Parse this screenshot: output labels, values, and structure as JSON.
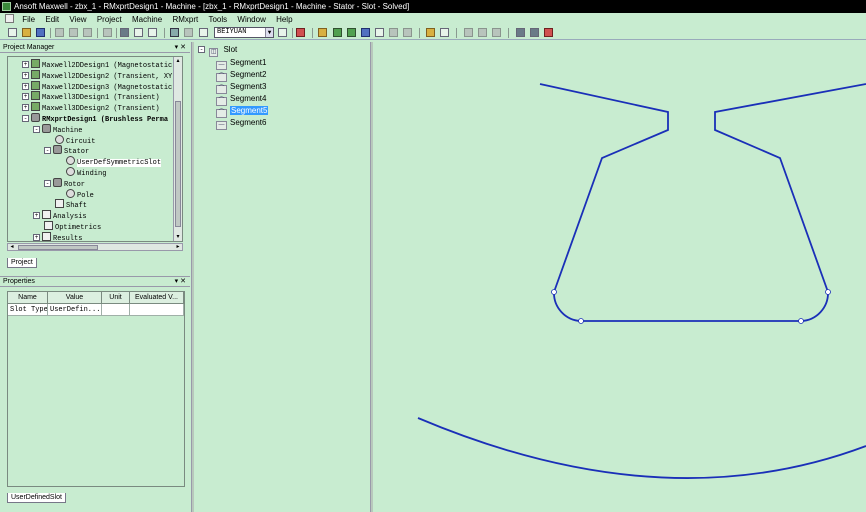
{
  "window": {
    "title": "Ansoft Maxwell  - zbx_1 - RMxprtDesign1 - Machine - [zbx_1 - RMxprtDesign1 - Machine - Stator - Slot - Solved]"
  },
  "menu": [
    "File",
    "Edit",
    "View",
    "Project",
    "Machine",
    "RMxprt",
    "Tools",
    "Window",
    "Help"
  ],
  "toolbar": {
    "combo_value": "BEIYUAN"
  },
  "project_manager": {
    "title": "Project Manager",
    "tree": [
      {
        "label": "Maxwell2DDesign1 (Magnetostatic, XY)",
        "level": 1,
        "expander": "+",
        "icon": "maxwell2d-icon",
        "bold": false
      },
      {
        "label": "Maxwell2DDesign2 (Transient, XY)",
        "level": 1,
        "expander": "+",
        "icon": "maxwell2d-icon",
        "bold": false
      },
      {
        "label": "Maxwell2DDesign3 (Magnetostatic, XY)",
        "level": 1,
        "expander": "+",
        "icon": "maxwell2d-icon",
        "bold": false
      },
      {
        "label": "Maxwell3DDesign1 (Transient)",
        "level": 1,
        "expander": "+",
        "icon": "maxwell3d-icon",
        "bold": false
      },
      {
        "label": "Maxwell3DDesign2 (Transient)",
        "level": 1,
        "expander": "+",
        "icon": "maxwell3d-icon",
        "bold": false
      },
      {
        "label": "RMxprtDesign1 (Brushless Perma",
        "level": 1,
        "expander": "-",
        "icon": "rmxprt-icon",
        "bold": true
      },
      {
        "label": "Machine",
        "level": 2,
        "expander": "-",
        "icon": "machine-icon",
        "bold": false
      },
      {
        "label": "Circuit",
        "level": 3,
        "expander": "",
        "icon": "circuit-icon",
        "bold": false
      },
      {
        "label": "Stator",
        "level": 3,
        "expander": "-",
        "icon": "stator-icon",
        "bold": false
      },
      {
        "label": "UserDefSymmetricSlot",
        "level": 4,
        "expander": "",
        "icon": "slot-icon",
        "bold": false,
        "selected": true
      },
      {
        "label": "Winding",
        "level": 4,
        "expander": "",
        "icon": "winding-icon",
        "bold": false
      },
      {
        "label": "Rotor",
        "level": 3,
        "expander": "-",
        "icon": "rotor-icon",
        "bold": false
      },
      {
        "label": "Pole",
        "level": 4,
        "expander": "",
        "icon": "pole-icon",
        "bold": false
      },
      {
        "label": "Shaft",
        "level": 3,
        "expander": "",
        "icon": "shaft-icon",
        "bold": false
      },
      {
        "label": "Analysis",
        "level": 2,
        "expander": "+",
        "icon": "analysis-icon",
        "bold": false
      },
      {
        "label": "Optimetrics",
        "level": 2,
        "expander": "",
        "icon": "optimetrics-icon",
        "bold": false
      },
      {
        "label": "Results",
        "level": 2,
        "expander": "+",
        "icon": "results-icon",
        "bold": false
      }
    ],
    "tab": "Project"
  },
  "properties": {
    "title": "Properties",
    "columns": [
      "Name",
      "Value",
      "Unit",
      "Evaluated V..."
    ],
    "rows": [
      [
        "Slot Type",
        "UserDefin...",
        "",
        ""
      ]
    ],
    "tab": "UserDefinedSlot"
  },
  "slot_tree": {
    "root": "Slot",
    "segments": [
      "Segment1",
      "Segment2",
      "Segment3",
      "Segment4",
      "Segment5",
      "Segment6"
    ],
    "segment_icons": [
      "line",
      "arc",
      "arc",
      "arc",
      "arc",
      "line"
    ],
    "selected_index": 4
  },
  "colors": {
    "outline": "#1a2fb8",
    "background": "#c8ecd0",
    "selection": "#3399ff"
  }
}
